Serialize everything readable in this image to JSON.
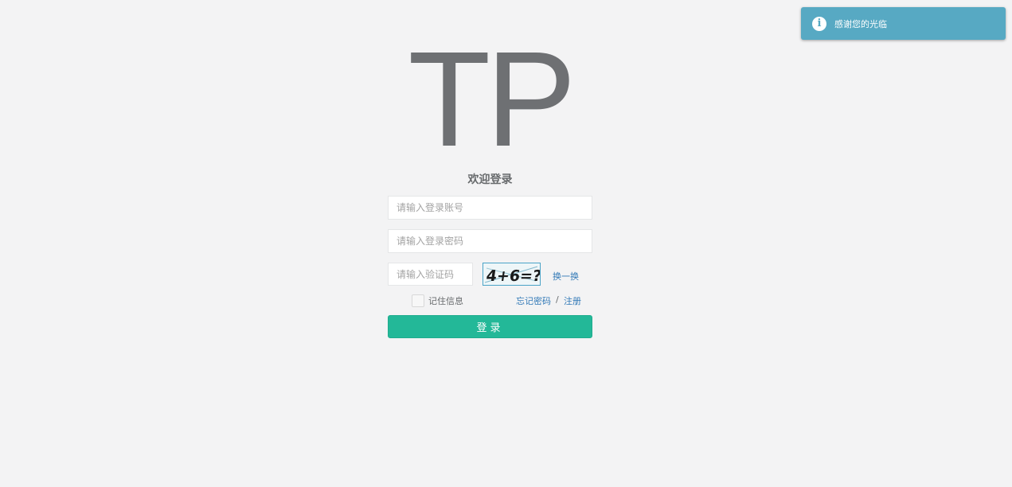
{
  "logo": {
    "text": "TP"
  },
  "form": {
    "title": "欢迎登录",
    "account_placeholder": "请输入登录账号",
    "password_placeholder": "请输入登录密码",
    "captcha_placeholder": "请输入验证码",
    "captcha_image_text": "4+6=?",
    "refresh_label": "换一换",
    "remember_label": "记住信息",
    "remember_checked": false,
    "forgot_label": "忘记密码",
    "separator": "/",
    "register_label": "注册",
    "login_label": "登录"
  },
  "toast": {
    "icon": "info-icon",
    "icon_glyph": "i",
    "message": "感谢您的光临"
  },
  "colors": {
    "background": "#f3f3f4",
    "primary_button": "#23b898",
    "link": "#337ab7",
    "toast": "#57a9c3"
  }
}
